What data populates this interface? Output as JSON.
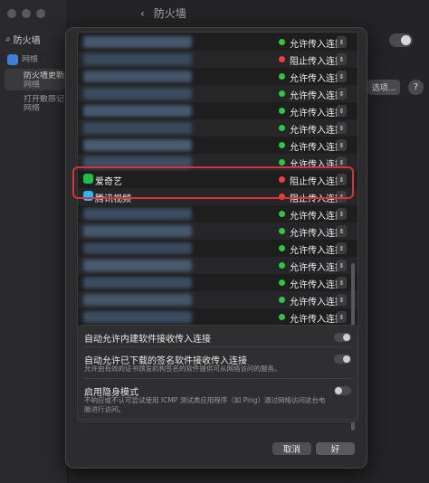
{
  "titlebar": {
    "back_glyph": "‹",
    "title": "防火墙"
  },
  "sidebar": {
    "search_text": "防火墙",
    "items": [
      {
        "label": "网络"
      },
      {
        "label": "防火墙更新"
      },
      {
        "label": "网络"
      },
      {
        "label": "打开敏感记"
      },
      {
        "label": "网络"
      }
    ]
  },
  "background": {
    "options_label": "选项...",
    "help_label": "?"
  },
  "apps": [
    {
      "name": "",
      "blurred": true,
      "status": "允许传入连接",
      "status_color": "#31c446",
      "blur_color": "#45586f"
    },
    {
      "name": "",
      "blurred": true,
      "status": "阻止传入连接",
      "status_color": "#ee4043",
      "blur_color": "#3a4a5e"
    },
    {
      "name": "",
      "blurred": true,
      "status": "允许传入连接",
      "status_color": "#31c446",
      "blur_color": "#44546a"
    },
    {
      "name": "",
      "blurred": true,
      "status": "允许传入连接",
      "status_color": "#31c446",
      "blur_color": "#3c4b60"
    },
    {
      "name": "",
      "blurred": true,
      "status": "允许传入连接",
      "status_color": "#31c446",
      "blur_color": "#465870"
    },
    {
      "name": "",
      "blurred": true,
      "status": "允许传入连接",
      "status_color": "#31c446",
      "blur_color": "#3a4a5e"
    },
    {
      "name": "",
      "blurred": true,
      "status": "允许传入连接",
      "status_color": "#31c446",
      "blur_color": "#4a5c72"
    },
    {
      "name": "",
      "blurred": true,
      "status": "允许传入连接",
      "status_color": "#31c446",
      "blur_color": "#3e4e63"
    },
    {
      "name": "爱奇艺",
      "blurred": false,
      "status": "阻止传入连接",
      "status_color": "#ee4043",
      "icon_color": "#1fbe4a"
    },
    {
      "name": "腾讯视频",
      "blurred": false,
      "status": "阻止传入连接",
      "status_color": "#ee4043",
      "icon_color": "#2bb7f0"
    },
    {
      "name": "",
      "blurred": true,
      "status": "允许传入连接",
      "status_color": "#31c446",
      "blur_color": "#3c4c62"
    },
    {
      "name": "",
      "blurred": true,
      "status": "允许传入连接",
      "status_color": "#31c446",
      "blur_color": "#46586e"
    },
    {
      "name": "",
      "blurred": true,
      "status": "允许传入连接",
      "status_color": "#31c446",
      "blur_color": "#3a4a5f"
    },
    {
      "name": "",
      "blurred": true,
      "status": "允许传入连接",
      "status_color": "#31c446",
      "blur_color": "#485a70"
    },
    {
      "name": "",
      "blurred": true,
      "status": "允许传入连接",
      "status_color": "#31c446",
      "blur_color": "#3b4b60"
    },
    {
      "name": "",
      "blurred": true,
      "status": "允许传入连接",
      "status_color": "#31c446",
      "blur_color": "#44566c"
    },
    {
      "name": "",
      "blurred": true,
      "status": "允许传入连接",
      "status_color": "#31c446",
      "blur_color": "#3d4d62"
    }
  ],
  "list_controls": {
    "add": "+",
    "remove": "−"
  },
  "options": {
    "builtin": {
      "title": "自动允许内建软件接收传入连接",
      "on": true
    },
    "signed": {
      "title": "自动允许已下载的签名软件接收传入连接",
      "desc": "允许由有效的证书颁发机构签名的软件提供可从网络访问的服务。",
      "on": true
    },
    "stealth": {
      "title": "启用隐身模式",
      "desc": "不响应或不认可尝试使用 ICMP 测试类应用程序（如 Ping）通过网络访问这台电脑进行访问。",
      "on": false
    }
  },
  "buttons": {
    "cancel": "取消",
    "ok": "好"
  },
  "colors": {
    "highlight": "#d9323a",
    "allow": "#31c446",
    "block": "#ee4043"
  }
}
